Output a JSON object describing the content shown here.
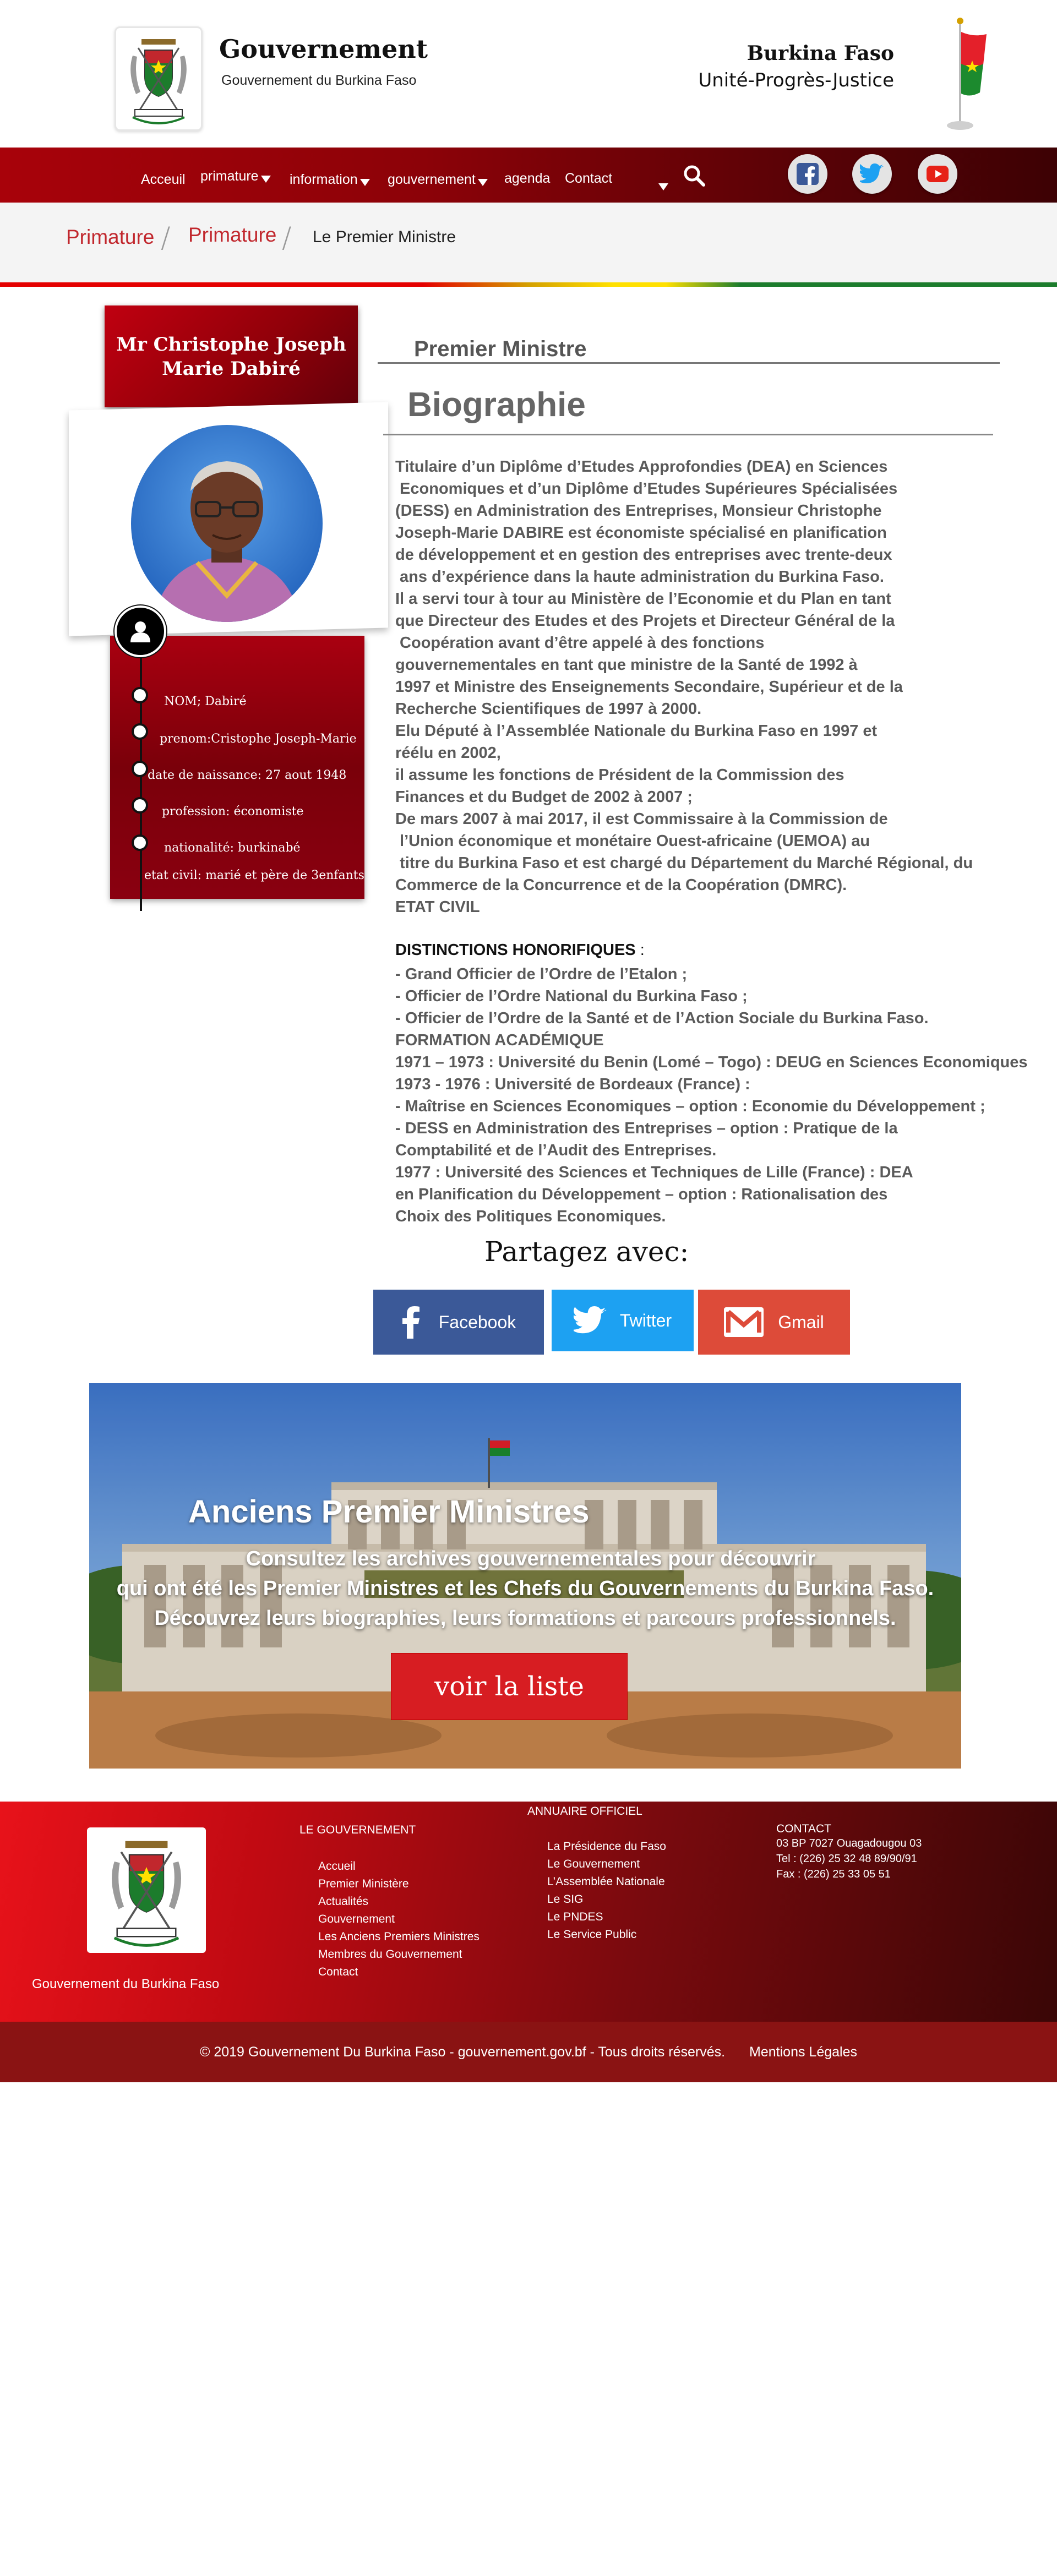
{
  "header": {
    "title": "Gouvernement",
    "subtitle": "Gouvernement du Burkina Faso",
    "country": "Burkina Faso",
    "motto": "Unité-Progrès-Justice"
  },
  "nav": {
    "items": [
      {
        "label": "Acceuil",
        "dropdown": false
      },
      {
        "label": "primature",
        "dropdown": true
      },
      {
        "label": "information",
        "dropdown": true
      },
      {
        "label": "gouvernement",
        "dropdown": true
      },
      {
        "label": "agenda",
        "dropdown": false
      },
      {
        "label": "Contact",
        "dropdown": false
      }
    ],
    "social": [
      "facebook-icon",
      "twitter-icon",
      "youtube-icon"
    ]
  },
  "breadcrumb": {
    "items": [
      "Primature",
      "Primature"
    ],
    "current": "Le Premier Ministre"
  },
  "profile": {
    "name": "Mr Christophe Joseph Marie Dabiré",
    "fields": [
      "NOM;  Dabiré",
      "prenom:Cristophe Joseph-Marie",
      "date de naissance: 27 aout 1948",
      "profession: économiste",
      "nationalité: burkinabé",
      "etat civil: marié et père de 3enfants"
    ]
  },
  "main": {
    "kicker": "Premier Ministre",
    "heading": "Biographie",
    "biography": "Titulaire d’un Diplôme d’Etudes Approfondies (DEA) en Sciences\n Economiques et d’un Diplôme d’Etudes Supérieures Spécialisées\n(DESS) en Administration des Entreprises, Monsieur Christophe\nJoseph-Marie DABIRE est économiste spécialisé en planification\nde développement et en gestion des entreprises avec trente-deux\n ans d’expérience dans la haute administration du Burkina Faso.\nIl a servi tour à tour au Ministère de l’Economie et du Plan en tant\nque Directeur des Etudes et des Projets et Directeur Général de la\n Coopération avant d’être appelé à des fonctions\ngouvernementales en tant que ministre de la Santé de 1992 à\n1997 et Ministre des Enseignements Secondaire, Supérieur et de la\nRecherche Scientifiques de 1997 à 2000.\nElu Député à l’Assemblée Nationale du Burkina Faso en 1997 et\nréélu en 2002,\nil assume les fonctions de Président de la Commission des\nFinances et du Budget de 2002 à 2007 ;\nDe mars 2007 à mai 2017, il est Commissaire à la Commission de\n l’Union économique et monétaire Ouest-africaine (UEMOA) au\n titre du Burkina Faso et est chargé du Département du Marché Régional, du\nCommerce de la Concurrence et de la Coopération (DMRC).\nETAT CIVIL",
    "distinctions_title": "DISTINCTIONS HONORIFIQUES",
    "distinctions_colon": " :",
    "distinctions": "- Grand Officier de l’Ordre de l’Etalon ;\n- Officier de l’Ordre National du Burkina Faso ;\n- Officier de l’Ordre de la Santé et de l’Action Sociale du Burkina Faso.\nFORMATION ACADÉMIQUE\n1971 – 1973 : Université du Benin (Lomé – Togo) : DEUG en Sciences Economiques\n1973 - 1976 : Université de Bordeaux (France) :\n- Maîtrise en Sciences Economiques – option : Economie du Développement ;\n- DESS en Administration des Entreprises – option : Pratique de la\nComptabilité et de l’Audit des Entreprises.\n1977 : Université des Sciences et Techniques de Lille (France) : DEA\nen Planification du Développement – option : Rationalisation des\nChoix des Politiques Economiques."
  },
  "share": {
    "title": "Partagez avec:",
    "facebook": "Facebook",
    "twitter": "Twitter",
    "gmail": "Gmail",
    "colors": {
      "facebook": "#3b5998",
      "twitter": "#1da1f2",
      "gmail": "#dd4b39"
    }
  },
  "banner": {
    "title": "Anciens Premier Ministres",
    "line1": "Consultez les archives gouvernementales pour découvrir",
    "line2": "qui ont été les Premier Ministres et les Chefs du Gouvernements du Burkina Faso.",
    "line3": "Découvrez leurs biographies, leurs formations et parcours professionnels.",
    "button": "voir la liste"
  },
  "footer": {
    "caption": "Gouvernement du Burkina Faso",
    "gouv_title": "LE GOUVERNEMENT",
    "gouv_links": [
      "Accueil",
      "Premier Ministère",
      "Actualités",
      "Gouvernement",
      "Les Anciens Premiers Ministres",
      "Membres du Gouvernement",
      "Contact"
    ],
    "annuaire_title": "ANNUAIRE OFFICIEL",
    "annuaire_links": [
      "La Présidence du Faso",
      "Le Gouvernement",
      "L’Assemblée Nationale",
      "Le SIG",
      "Le PNDES",
      "Le Service Public"
    ],
    "contact_title": "CONTACT",
    "contact_lines": [
      "03 BP 7027 Ouagadougou 03",
      "Tel : (226) 25 32 48 89/90/91",
      "Fax : (226) 25 33 05 51"
    ],
    "copyright": "© 2019 Gouvernement Du Burkina Faso - gouvernement.gov.bf - Tous droits réservés.",
    "legal": "Mentions Légales"
  },
  "colors": {
    "primary_red": "#a8020a",
    "breadcrumb_red": "#c1272d",
    "cta_red": "#d71d22",
    "copyright_bar": "#8a1313"
  }
}
